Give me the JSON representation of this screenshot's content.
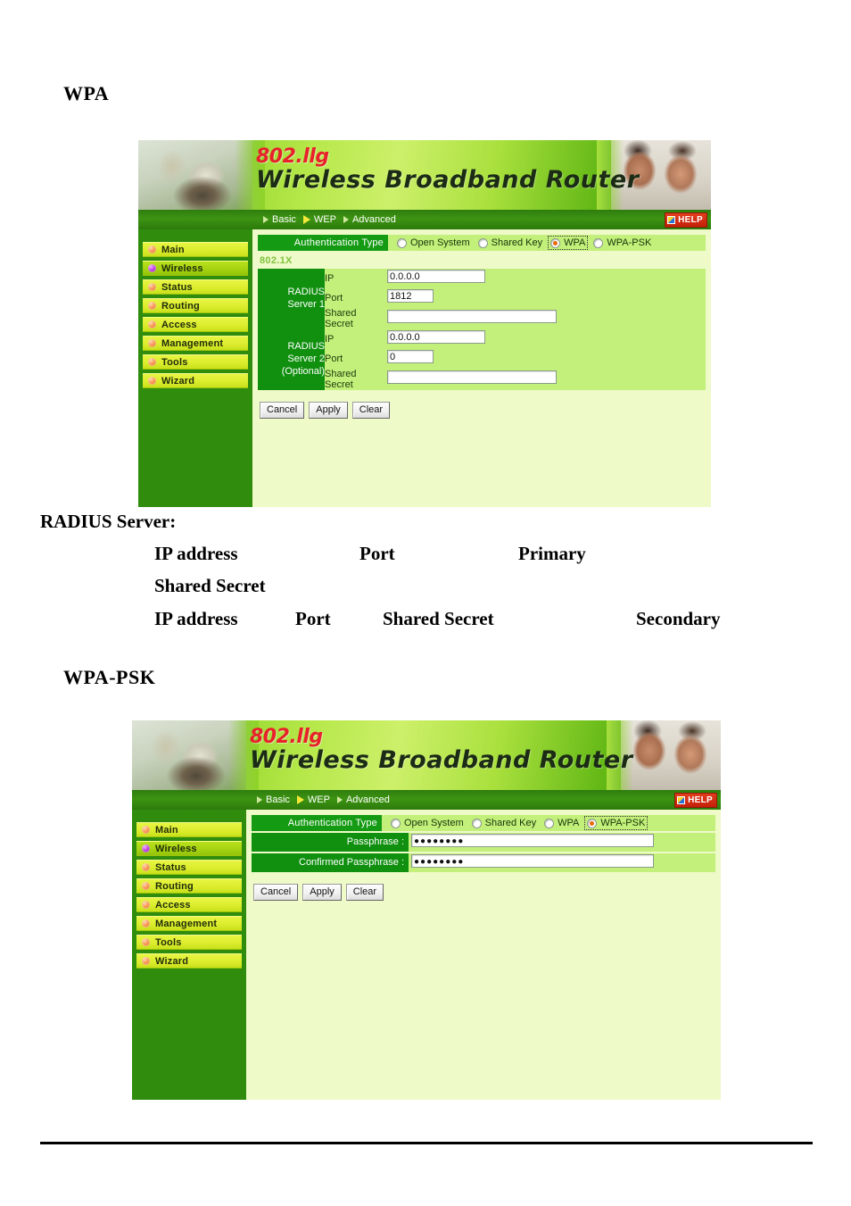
{
  "document": {
    "heading_wpa": "WPA",
    "heading_wpapsk": "WPA-PSK",
    "radius_server_label": "RADIUS Server:",
    "legend": {
      "ip_address_1": "IP address",
      "port_1": "Port",
      "primary": "Primary",
      "shared_secret_1": "Shared Secret",
      "ip_address_2": "IP address",
      "port_2": "Port",
      "shared_secret_2": "Shared Secret",
      "secondary": "Secondary"
    }
  },
  "banner": {
    "brand_small": "802.llg",
    "brand_main": "Wireless  Broadband  Router",
    "nav": [
      {
        "label": "Basic",
        "highlighted": false
      },
      {
        "label": "WEP",
        "highlighted": true
      },
      {
        "label": "Advanced",
        "highlighted": false
      }
    ],
    "help_label": "HELP"
  },
  "sidebar": {
    "items": [
      {
        "label": "Main",
        "active": false
      },
      {
        "label": "Wireless",
        "active": true
      },
      {
        "label": "Status",
        "active": false
      },
      {
        "label": "Routing",
        "active": false
      },
      {
        "label": "Access",
        "active": false
      },
      {
        "label": "Management",
        "active": false
      },
      {
        "label": "Tools",
        "active": false
      },
      {
        "label": "Wizard",
        "active": false
      }
    ]
  },
  "screen_wpa": {
    "auth_type_label": "Authentication Type",
    "options": [
      {
        "label": "Open System",
        "checked": false,
        "focused": false
      },
      {
        "label": "Shared Key",
        "checked": false,
        "focused": false
      },
      {
        "label": "WPA",
        "checked": true,
        "focused": true
      },
      {
        "label": "WPA-PSK",
        "checked": false,
        "focused": false
      }
    ],
    "section_802_1x": "802.1X",
    "servers": [
      {
        "name": "RADIUS Server 1",
        "optional": "",
        "fields": [
          {
            "label": "IP",
            "value": "0.0.0.0",
            "width": "w-ip"
          },
          {
            "label": "Port",
            "value": "1812",
            "width": "w-port"
          },
          {
            "label": "Shared Secret",
            "value": "",
            "width": "w-ss"
          }
        ]
      },
      {
        "name": "RADIUS Server 2",
        "optional": "(Optional)",
        "fields": [
          {
            "label": "IP",
            "value": "0.0.0.0",
            "width": "w-ip"
          },
          {
            "label": "Port",
            "value": "0",
            "width": "w-port"
          },
          {
            "label": "Shared Secret",
            "value": "",
            "width": "w-ss"
          }
        ]
      }
    ],
    "buttons": [
      {
        "label": "Cancel"
      },
      {
        "label": "Apply"
      },
      {
        "label": "Clear"
      }
    ]
  },
  "screen_wpapsk": {
    "auth_type_label": "Authentication Type",
    "options": [
      {
        "label": "Open System",
        "checked": false,
        "focused": false
      },
      {
        "label": "Shared Key",
        "checked": false,
        "focused": false
      },
      {
        "label": "WPA",
        "checked": false,
        "focused": false
      },
      {
        "label": "WPA-PSK",
        "checked": true,
        "focused": true
      }
    ],
    "fields": [
      {
        "label": "Passphrase :",
        "value": "●●●●●●●●"
      },
      {
        "label": "Confirmed Passphrase :",
        "value": "●●●●●●●●"
      }
    ],
    "buttons": [
      {
        "label": "Cancel"
      },
      {
        "label": "Apply"
      },
      {
        "label": "Clear"
      }
    ]
  },
  "colors": {
    "sidebar_green": "#2f8c0d",
    "content_bg": "#eefac8",
    "field_row_bg": "#c3f07a",
    "label_green": "#119010",
    "brand_red": "#e8212a",
    "menu_yellow": "#dced2e"
  }
}
